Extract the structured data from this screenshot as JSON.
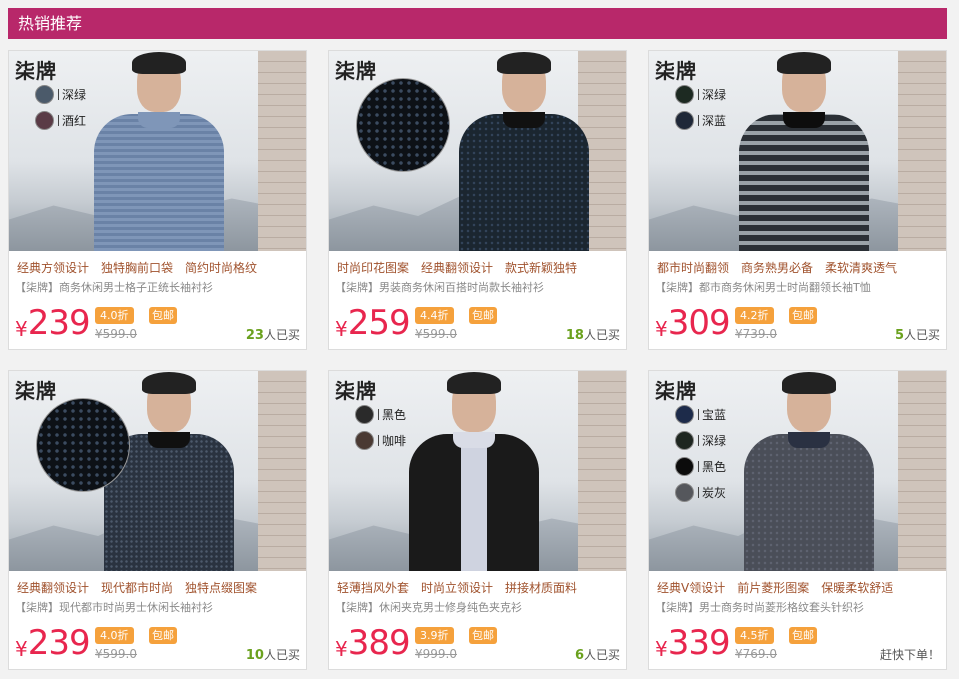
{
  "section_title": "热销推荐",
  "brand_text": "柒牌",
  "colors": {
    "header_bg": "#b8286a",
    "price": "#e8264e",
    "badge": "#f5a13c",
    "sold_count": "#6aa11e"
  },
  "products": [
    {
      "features": [
        "经典方领设计",
        "独特胸前口袋",
        "简约时尚格纹"
      ],
      "desc": "【柒牌】商务休闲男士格子正统长袖衬衫",
      "currency": "¥",
      "price": "239",
      "discount": "4.0折",
      "shipping": "包邮",
      "original_price": "¥599.0",
      "sold_count": "23",
      "sold_suffix": "人已买",
      "swatches": [
        {
          "label": "深绿",
          "color": "#4b5a6a"
        },
        {
          "label": "酒红",
          "color": "#5a3b46"
        }
      ]
    },
    {
      "features": [
        "时尚印花图案",
        "经典翻领设计",
        "款式新颖独特"
      ],
      "desc": "【柒牌】男装商务休闲百搭时尚款长袖衬衫",
      "currency": "¥",
      "price": "259",
      "discount": "4.4折",
      "shipping": "包邮",
      "original_price": "¥599.0",
      "sold_count": "18",
      "sold_suffix": "人已买",
      "swatches": []
    },
    {
      "features": [
        "都市时尚翻领",
        "商务熟男必备",
        "柔软清爽透气"
      ],
      "desc": "【柒牌】都市商务休闲男士时尚翻领长袖T恤",
      "currency": "¥",
      "price": "309",
      "discount": "4.2折",
      "shipping": "包邮",
      "original_price": "¥739.0",
      "sold_count": "5",
      "sold_suffix": "人已买",
      "swatches": [
        {
          "label": "深绿",
          "color": "#1d2a22"
        },
        {
          "label": "深蓝",
          "color": "#1f2838"
        }
      ]
    },
    {
      "features": [
        "经典翻领设计",
        "现代都市时尚",
        "独特点缀图案"
      ],
      "desc": "【柒牌】现代都市时尚男士休闲长袖衬衫",
      "currency": "¥",
      "price": "239",
      "discount": "4.0折",
      "shipping": "包邮",
      "original_price": "¥599.0",
      "sold_count": "10",
      "sold_suffix": "人已买",
      "swatches": []
    },
    {
      "features": [
        "轻薄挡风外套",
        "时尚立领设计",
        "拼接材质面料"
      ],
      "desc": "【柒牌】休闲夹克男士修身纯色夹克衫",
      "currency": "¥",
      "price": "389",
      "discount": "3.9折",
      "shipping": "包邮",
      "original_price": "¥999.0",
      "sold_count": "6",
      "sold_suffix": "人已买",
      "swatches": [
        {
          "label": "黑色",
          "color": "#2a2a2a"
        },
        {
          "label": "咖啡",
          "color": "#4a3a33"
        }
      ]
    },
    {
      "features": [
        "经典V领设计",
        "前片菱形图案",
        "保暖柔软舒适"
      ],
      "desc": "【柒牌】男士商务时尚菱形格纹套头针织衫",
      "currency": "¥",
      "price": "339",
      "discount": "4.5折",
      "shipping": "包邮",
      "original_price": "¥769.0",
      "sold_count": "",
      "sold_suffix": "赶快下单！",
      "swatches": [
        {
          "label": "宝蓝",
          "color": "#1d2b4a"
        },
        {
          "label": "深绿",
          "color": "#1e2620"
        },
        {
          "label": "黑色",
          "color": "#0c0c0c"
        },
        {
          "label": "炭灰",
          "color": "#55575c"
        }
      ]
    }
  ]
}
